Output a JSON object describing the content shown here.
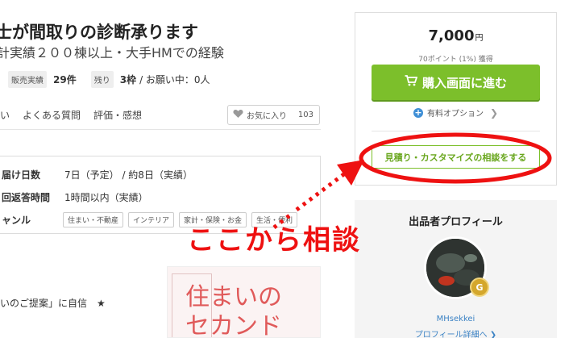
{
  "header": {
    "title": "士が間取りの診断承ります",
    "subtitle": "計実績２００棟以上・大手HMでの経験"
  },
  "stats": {
    "sales_tag": "販売実績",
    "sales_value": "29件",
    "remaining_tag": "残り",
    "remaining_value": "3枠",
    "request_text": "/ お願い中：0人"
  },
  "tabs": [
    {
      "label": "い"
    },
    {
      "label": "よくある質問"
    },
    {
      "label": "評価・感想"
    }
  ],
  "favorite": {
    "label": "お気に入り",
    "count": "103"
  },
  "info": {
    "delivery_label": "届け日数",
    "delivery_value": "7日（予定） / 約8日（実績）",
    "response_label": "回返答時間",
    "response_value": "1時間以内（実績）",
    "genre_label": "ャンル",
    "categories": [
      "住まい・不動産",
      "インテリア",
      "家計・保険・お金",
      "生活・便利"
    ]
  },
  "bottom_text": "いのご提案」に自信　★",
  "thumbnail": {
    "line1": "住まいの",
    "line2": "セカンド"
  },
  "purchase": {
    "price": "7,000",
    "currency": "円",
    "points": "70ポイント (1%) 獲得",
    "buy_button": "購入画面に進む",
    "option_label": "有料オプション",
    "quote_button": "見積り・カスタマイズの相談をする"
  },
  "profile": {
    "title": "出品者プロフィール",
    "badge": "G",
    "username": "MHsekkei",
    "detail_link": "プロフィール詳細へ ❯"
  },
  "annotation": {
    "text": "ここから相談",
    "color": "#ee1111"
  },
  "colors": {
    "accent_green": "#7cbf2b",
    "link_blue": "#3b82c4"
  }
}
